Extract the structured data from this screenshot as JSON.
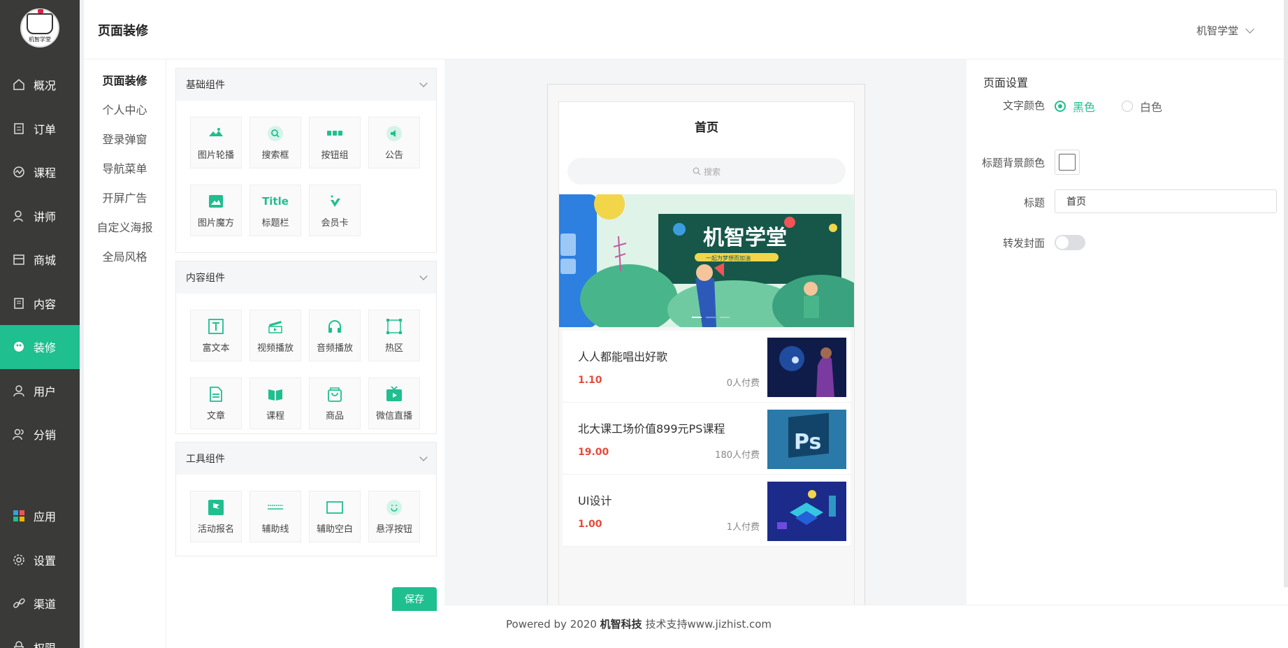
{
  "sidebar": {
    "logo_text": "机智学堂",
    "items": [
      {
        "label": "概况",
        "icon": "home-icon"
      },
      {
        "label": "订单",
        "icon": "order-icon"
      },
      {
        "label": "课程",
        "icon": "course-icon"
      },
      {
        "label": "讲师",
        "icon": "teacher-icon"
      },
      {
        "label": "商城",
        "icon": "shop-icon"
      },
      {
        "label": "内容",
        "icon": "content-icon"
      },
      {
        "label": "装修",
        "icon": "decorate-icon",
        "active": true
      },
      {
        "label": "用户",
        "icon": "user-icon"
      },
      {
        "label": "分销",
        "icon": "distribution-icon"
      }
    ],
    "bottom_items": [
      {
        "label": "应用",
        "icon": "apps-icon"
      },
      {
        "label": "设置",
        "icon": "gear-icon"
      },
      {
        "label": "渠道",
        "icon": "link-icon"
      },
      {
        "label": "权限",
        "icon": "lock-icon"
      }
    ]
  },
  "header": {
    "title": "页面装修",
    "user": "机智学堂"
  },
  "subnav": {
    "items": [
      "页面装修",
      "个人中心",
      "登录弹窗",
      "导航菜单",
      "开屏广告",
      "自定义海报",
      "全局风格"
    ],
    "active": "页面装修"
  },
  "components": {
    "groups": [
      {
        "title": "基础组件",
        "items": [
          "图片轮播",
          "搜索框",
          "按钮组",
          "公告",
          "图片魔方",
          "标题栏",
          "会员卡"
        ]
      },
      {
        "title": "内容组件",
        "items": [
          "富文本",
          "视频播放",
          "音频播放",
          "热区",
          "文章",
          "课程",
          "商品",
          "微信直播"
        ]
      },
      {
        "title": "工具组件",
        "items": [
          "活动报名",
          "辅助线",
          "辅助空白",
          "悬浮按钮"
        ]
      }
    ],
    "title_tile_text": "Title",
    "save_label": "保存"
  },
  "preview": {
    "title": "首页",
    "search_placeholder": "搜索",
    "banner_title": "机智学堂",
    "banner_subtitle": "一起为梦想而加油",
    "courses": [
      {
        "name": "人人都能唱出好歌",
        "price": "1.10",
        "paid": "0人付费"
      },
      {
        "name": "北大课工场价值899元PS课程",
        "price": "19.00",
        "paid": "180人付费"
      },
      {
        "name": "UI设计",
        "price": "1.00",
        "paid": "1人付费"
      }
    ]
  },
  "settings": {
    "title": "页面设置",
    "text_color_label": "文字颜色",
    "text_color_options": [
      "黑色",
      "白色"
    ],
    "text_color_selected": "黑色",
    "title_bg_label": "标题背景颜色",
    "title_label": "标题",
    "title_value": "首页",
    "share_cover_label": "转发封面"
  },
  "footer": {
    "prefix": "Powered by 2020",
    "brand": "机智科技",
    "suffix": "技术支持www.jizhist.com"
  },
  "colors": {
    "accent": "#1fbf8f",
    "sidebar_bg": "#3a3a38",
    "price": "#e64a3b"
  }
}
